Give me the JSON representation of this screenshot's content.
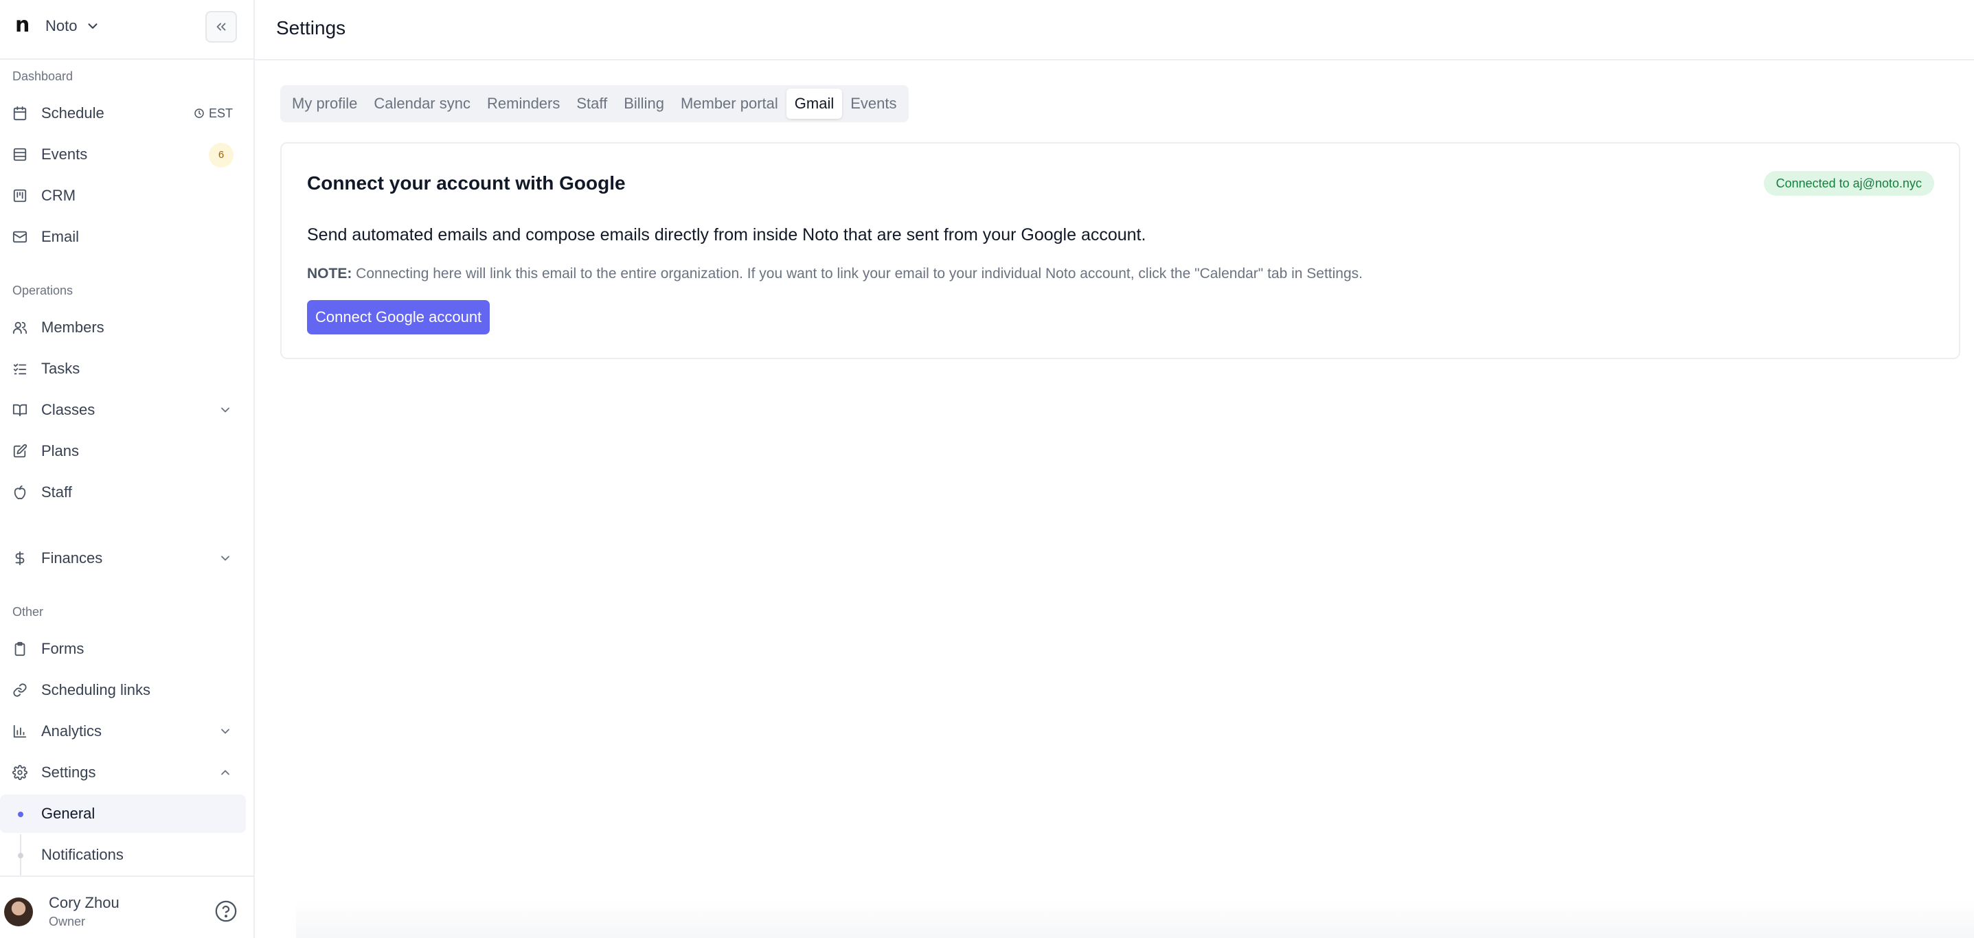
{
  "sidebar": {
    "org": {
      "logo": "n",
      "name": "Noto"
    },
    "sections": {
      "dashboard": "Dashboard",
      "operations": "Operations",
      "other": "Other"
    },
    "items": {
      "schedule": "Schedule",
      "timezone": "EST",
      "events": "Events",
      "events_count": "6",
      "crm": "CRM",
      "email": "Email",
      "members": "Members",
      "tasks": "Tasks",
      "classes": "Classes",
      "plans": "Plans",
      "staff": "Staff",
      "finances": "Finances",
      "forms": "Forms",
      "scheduling_links": "Scheduling links",
      "analytics": "Analytics",
      "settings": "Settings",
      "general": "General",
      "notifications": "Notifications"
    },
    "user": {
      "name": "Cory Zhou",
      "role": "Owner"
    }
  },
  "header": {
    "title": "Settings"
  },
  "tabs": [
    {
      "label": "My profile",
      "active": false
    },
    {
      "label": "Calendar sync",
      "active": false
    },
    {
      "label": "Reminders",
      "active": false
    },
    {
      "label": "Staff",
      "active": false
    },
    {
      "label": "Billing",
      "active": false
    },
    {
      "label": "Member portal",
      "active": false
    },
    {
      "label": "Gmail",
      "active": true
    },
    {
      "label": "Events",
      "active": false
    }
  ],
  "card": {
    "title": "Connect your account with Google",
    "status": "Connected to aj@noto.nyc",
    "description": "Send automated emails and compose emails directly from inside Noto that are sent from your Google account.",
    "note_label": "NOTE:",
    "note_text": " Connecting here will link this email to the entire organization. If you want to link your email to your individual Noto account, click the \"Calendar\" tab in Settings.",
    "button": "Connect Google account"
  },
  "colors": {
    "accent": "#6366f1",
    "success_bg": "#dff5e5",
    "success_text": "#15803d",
    "count_badge_bg": "#fdf6d8"
  }
}
